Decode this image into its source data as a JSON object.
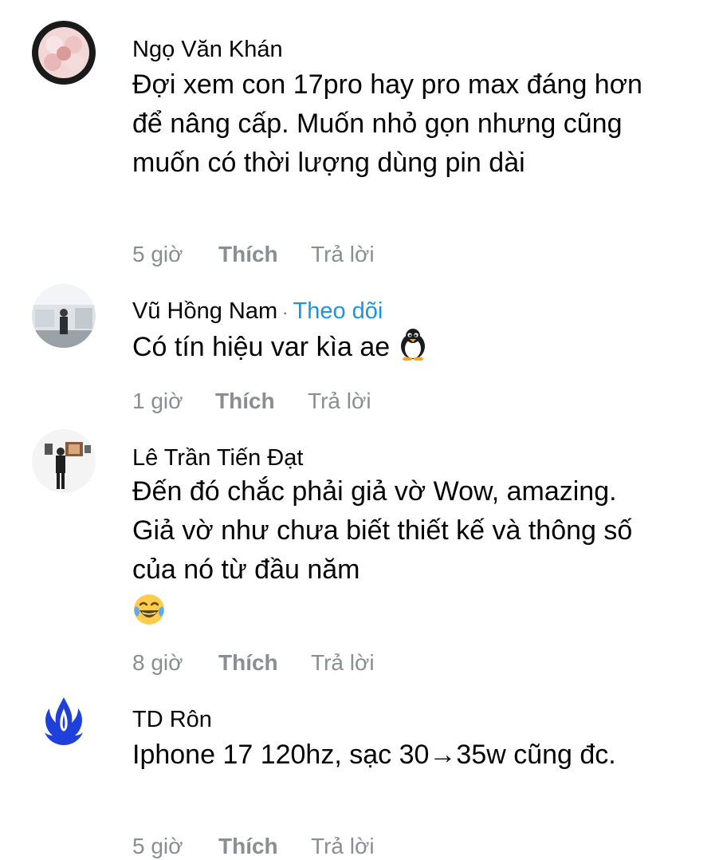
{
  "comments": [
    {
      "author": "Ngọ Văn Khán",
      "text": "Đợi xem con 17pro hay pro max đáng hơn để nâng cấp. Muốn nhỏ gọn nhưng cũng muốn có thời lượng dùng pin dài",
      "time": "5 giờ",
      "like": "Thích",
      "reply": "Trả lời"
    },
    {
      "author": "Vũ Hồng Nam",
      "separator": "·",
      "follow": "Theo dõi",
      "text": "Có tín hiệu var kìa ae",
      "emoji": "penguin-emoji",
      "time": "1 giờ",
      "like": "Thích",
      "reply": "Trả lời"
    },
    {
      "author": "Lê Trần Tiến Đạt",
      "text": "Đến đó chắc phải giả vờ Wow, amazing. Giả vờ như chưa biết thiết kế và thông số của nó từ đầu năm",
      "emoji": "laughing-tears-emoji",
      "time": "8 giờ",
      "like": "Thích",
      "reply": "Trả lời"
    },
    {
      "author": "TD Rôn",
      "text": "Iphone 17 120hz, sạc 30→35w cũng đc.",
      "time": "5 giờ",
      "like": "Thích",
      "reply": "Trả lời"
    }
  ],
  "colors": {
    "follow": "#1b95e0",
    "meta": "#8a8d91",
    "text": "#050505"
  }
}
